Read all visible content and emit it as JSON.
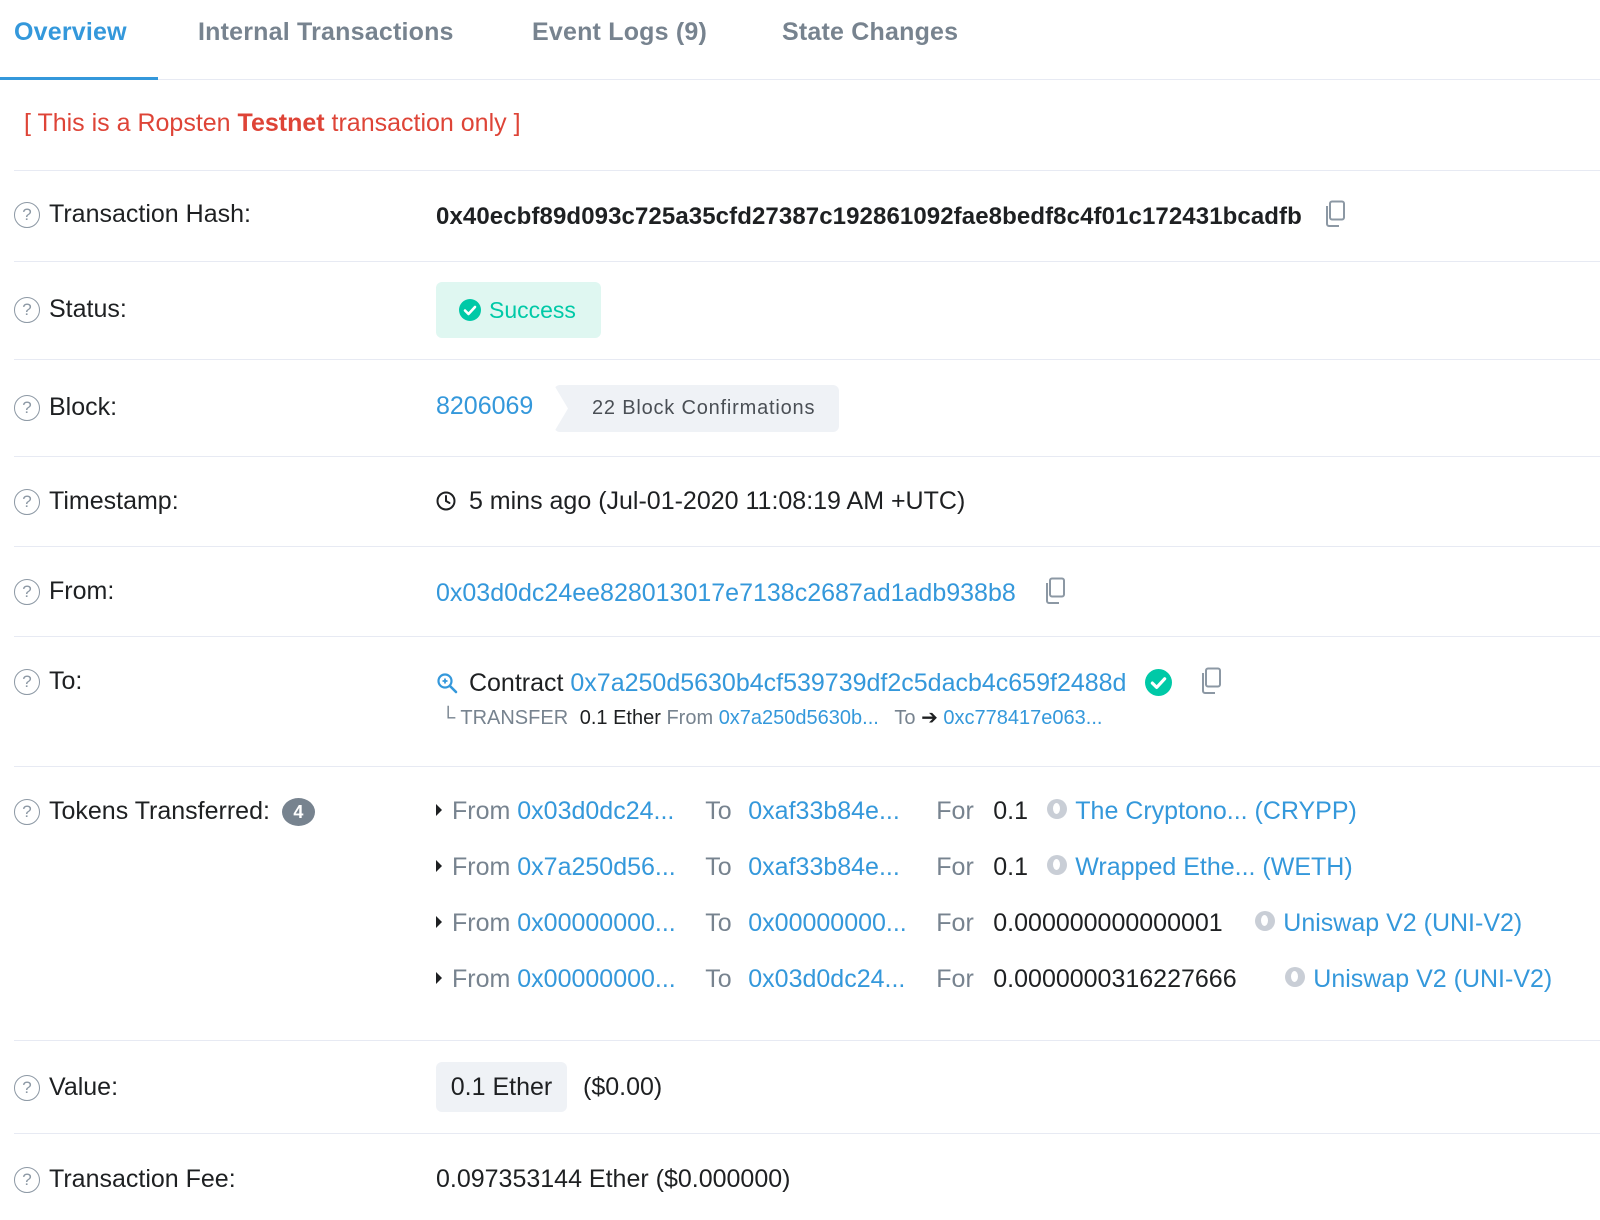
{
  "tabs": [
    {
      "label": "Overview",
      "active": true
    },
    {
      "label": "Internal Transactions",
      "active": false
    },
    {
      "label": "Event Logs (9)",
      "active": false
    },
    {
      "label": "State Changes",
      "active": false
    }
  ],
  "banner": {
    "prefix": "[ This is a Ropsten ",
    "bold": "Testnet",
    "suffix": " transaction only ]"
  },
  "rows": {
    "tx_hash": {
      "label": "Transaction Hash:",
      "value": "0x40ecbf89d093c725a35cfd27387c192861092fae8bedf8c4f01c172431bcadfb"
    },
    "status": {
      "label": "Status:",
      "value": "Success"
    },
    "block": {
      "label": "Block:",
      "number": "8206069",
      "confirmations": "22 Block Confirmations"
    },
    "timestamp": {
      "label": "Timestamp:",
      "value": "5 mins ago (Jul-01-2020 11:08:19 AM +UTC)"
    },
    "from": {
      "label": "From:",
      "address": "0x03d0dc24ee828013017e7138c2687ad1adb938b8"
    },
    "to": {
      "label": "To:",
      "prefix": "Contract",
      "address": "0x7a250d5630b4cf539739df2c5dacb4c659f2488d",
      "transfer": {
        "lead": "└ TRANSFER",
        "amount": "0.1 Ether",
        "from_label": "From",
        "from_addr": "0x7a250d5630b...",
        "to_label": "To",
        "to_addr": "0xc778417e063..."
      }
    },
    "tokens": {
      "label": "Tokens Transferred:",
      "count": "4",
      "items": [
        {
          "from_label": "From",
          "from": "0x03d0dc24...",
          "to_label": "To",
          "to": "0xaf33b84e...",
          "for_label": "For",
          "amount": "0.1",
          "token": "The Cryptono... (CRYPP)"
        },
        {
          "from_label": "From",
          "from": "0x7a250d56...",
          "to_label": "To",
          "to": "0xaf33b84e...",
          "for_label": "For",
          "amount": "0.1",
          "token": "Wrapped Ethe... (WETH)"
        },
        {
          "from_label": "From",
          "from": "0x00000000...",
          "to_label": "To",
          "to": "0x00000000...",
          "for_label": "For",
          "amount": "0.000000000000001",
          "token": "Uniswap V2 (UNI-V2)"
        },
        {
          "from_label": "From",
          "from": "0x00000000...",
          "to_label": "To",
          "to": "0x03d0dc24...",
          "for_label": "For",
          "amount": "0.0000000316227666",
          "token": "Uniswap V2 (UNI-V2)"
        }
      ]
    },
    "value": {
      "label": "Value:",
      "amount": "0.1 Ether",
      "usd": "($0.00)"
    },
    "fee": {
      "label": "Transaction Fee:",
      "value": "0.097353144 Ether ($0.000000)"
    }
  },
  "colors": {
    "link": "#3498db",
    "success": "#00c9a7",
    "testnet_red": "#de4437",
    "muted": "#77838f"
  }
}
